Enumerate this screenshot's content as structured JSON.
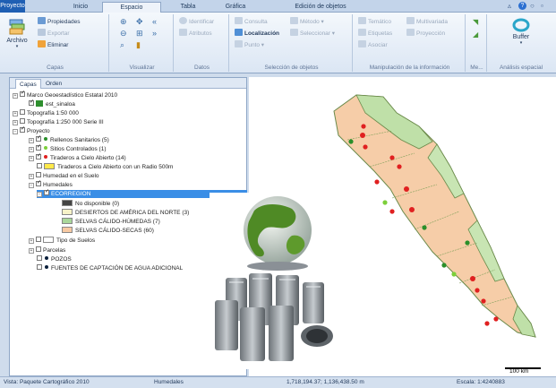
{
  "ribbon": {
    "tabs": [
      "Proyecto",
      "Inicio",
      "Espacio",
      "Tabla",
      "Gráfica",
      "Edición de objetos"
    ],
    "active_tab": "Espacio",
    "groups": {
      "capas": {
        "label": "Capas",
        "archivo": "Archivo",
        "propiedades": "Propiedades",
        "exportar": "Exportar",
        "eliminar": "Eliminar"
      },
      "visualizar": {
        "label": "Visualizar"
      },
      "datos": {
        "label": "Datos",
        "identificar": "Identificar",
        "atributos": "Atributos"
      },
      "seleccion": {
        "label": "Selección de objetos",
        "consulta": "Consulta",
        "localizacion": "Localización",
        "punto": "Punto",
        "metodo": "Método",
        "seleccionar": "Seleccionar"
      },
      "manipulacion": {
        "label": "Manipulación de la información",
        "tematico": "Temático",
        "multivariada": "Multivariada",
        "etiquetas": "Etiquetas",
        "proyeccion": "Proyección",
        "asociar": "Asociar"
      },
      "me": {
        "label": "Me..."
      },
      "analisis": {
        "label": "Análisis espacial",
        "buffer": "Buffer"
      }
    }
  },
  "panel": {
    "tabs": [
      "Capas",
      "Orden"
    ],
    "tree": [
      "Marco Geoestadístico Estatal 2010",
      "est_sinaloa",
      "Topografía 1:50 000",
      "Topografía 1:250 000 Serie III",
      "Proyecto",
      "Rellenos Sanitarios (5)",
      "Sitios Controlados (1)",
      "Tiraderos a Cielo Abierto (14)",
      "Tiraderos a Cielo Abierto con un Radio 500m",
      "Humedad en el Suelo",
      "Humedales",
      "ECORREGION",
      "No disponible (0)",
      "DESIERTOS DE AMÉRICA DEL NORTE (3)",
      "SELVAS CÁLIDO-HÚMEDAS (7)",
      "SELVAS CÁLIDO-SECAS (60)",
      "Tipo de Suelos",
      "Parcelas",
      "POZOS",
      "FUENTES DE CAPTACIÓN DE AGUA ADICIONAL"
    ]
  },
  "map": {
    "scalebar": "100 km"
  },
  "status": {
    "vista": "Vista: Paquete Cartográfico 2010",
    "layer": "Humedales",
    "coords": "1,718,194.37; 1,136,438.50 m",
    "escala": "Escala: 1:4240883"
  },
  "colors": {
    "relleno": "#2a8f2a",
    "sitio": "#7ccf3a",
    "tiradero": "#e02020",
    "radio": "#ffe94a",
    "desiertos": "#f7f2c8",
    "selvas_humedas": "#a9d79a",
    "selvas_secas": "#f7c9a2",
    "nodisp": "#444444"
  }
}
